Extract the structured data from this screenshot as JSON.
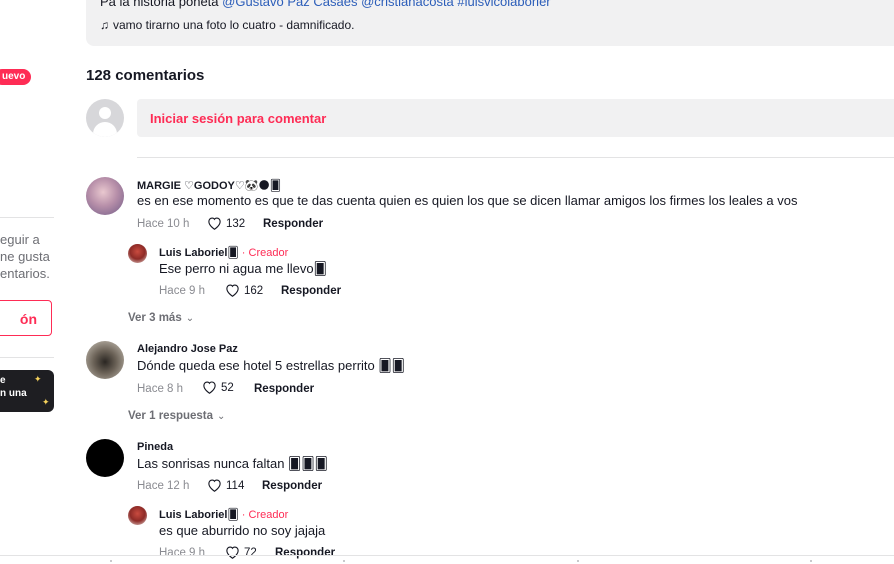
{
  "sidebar": {
    "new_badge": "uevo",
    "text_lines": [
      "eguir a",
      "ne gusta",
      "entarios."
    ],
    "login_button": "ón",
    "promo_lines": [
      "e",
      "n una"
    ]
  },
  "description": {
    "line1_prefix": "Pa la historia poneta",
    "mention1": "@Gustavo Paz Casaes",
    "mention2": "@cristianacosta",
    "mention3": "#luisvicolaborier",
    "music_text": "vamo tirarno una foto lo cuatro - damnificado."
  },
  "comments_header": {
    "count_label": "128 comentarios",
    "login_prompt": "Iniciar sesión para comentar"
  },
  "comments": [
    {
      "username": "MARGIE ♡GODOY♡🐼🌑🂠",
      "text": "es en ese momento es que te das cuenta quien es quien los que se dicen llamar amigos los firmes los leales a vos",
      "time": "Hace 10 h",
      "likes": "132",
      "reply_label": "Responder",
      "reply": {
        "username": "Luis  Laboriel🂠",
        "creator_label": "· Creador",
        "text": "Ese perro ni agua me llevo🂠",
        "time": "Hace 9 h",
        "likes": "162",
        "reply_label": "Responder"
      },
      "view_more": "Ver 3 más"
    },
    {
      "username": "Alejandro Jose Paz",
      "text": "Dónde queda ese hotel 5 estrellas perrito 🂠🂠",
      "time": "Hace 8 h",
      "likes": "52",
      "reply_label": "Responder",
      "view_more": "Ver 1 respuesta"
    },
    {
      "username": "Pineda",
      "text": "Las sonrisas nunca faltan 🂠🂠🂠",
      "time": "Hace 12 h",
      "likes": "114",
      "reply_label": "Responder",
      "reply": {
        "username": "Luis  Laboriel🂠",
        "creator_label": "· Creador",
        "text": "es que aburrido no soy jajaja",
        "time": "Hace 9 h",
        "likes": "72",
        "reply_label": "Responder"
      }
    }
  ],
  "colors": {
    "accent": "#fe2c55",
    "mention": "#2b5db9",
    "muted": "#8a8b91"
  }
}
